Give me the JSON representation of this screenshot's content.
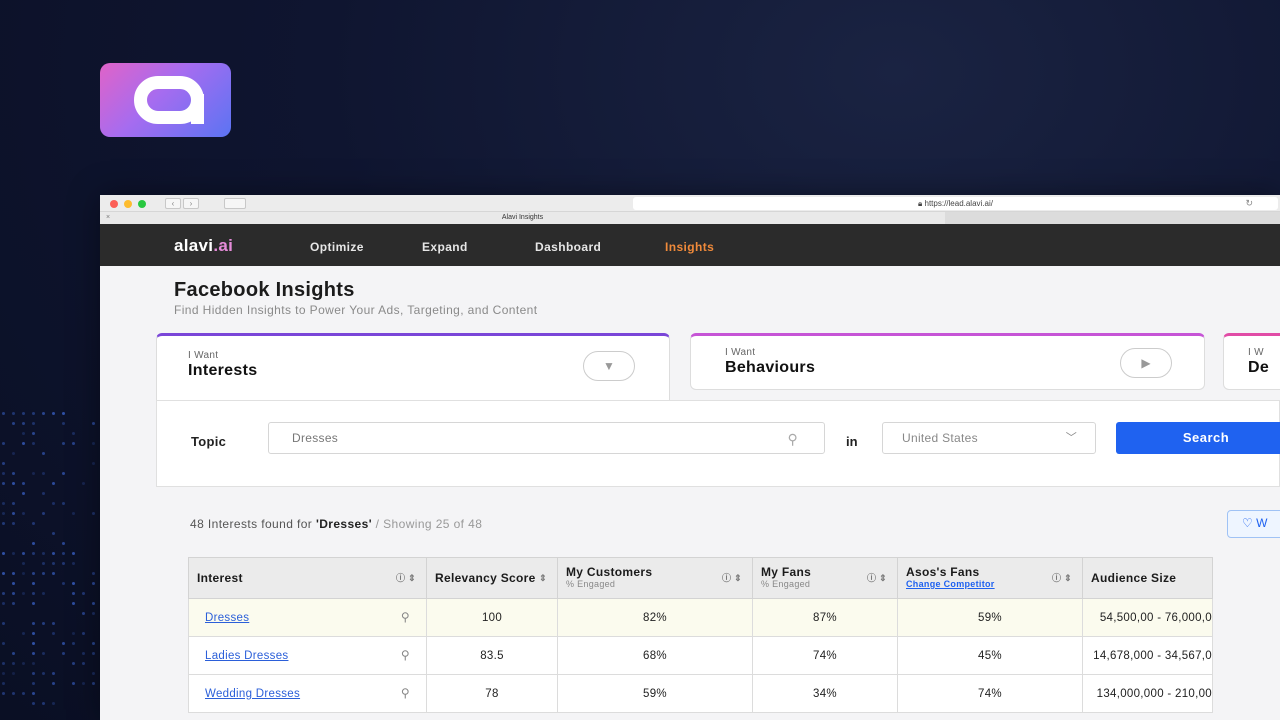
{
  "browser": {
    "url": "https://lead.alavi.ai/",
    "tab_title": "Alavi Insights"
  },
  "site": {
    "logo": "alavi",
    "logo_suffix": ".ai",
    "nav": [
      "Optimize",
      "Expand",
      "Dashboard",
      "Insights"
    ],
    "active_nav": "Insights"
  },
  "page": {
    "title": "Facebook Insights",
    "subtitle": "Find Hidden Insights to Power Your Ads, Targeting, and Content"
  },
  "cards": [
    {
      "label": "I Want",
      "title": "Interests"
    },
    {
      "label": "I Want",
      "title": "Behaviours"
    },
    {
      "label": "I W",
      "title": "De"
    }
  ],
  "search": {
    "topic_label": "Topic",
    "topic_value": "Dresses",
    "in_label": "in",
    "country": "United States",
    "button": "Search"
  },
  "results": {
    "count_text": "48 Interests found for ",
    "query": "'Dresses'",
    "showing": " / Showing 25 of 48",
    "action_button": "W"
  },
  "table": {
    "headers": [
      {
        "title": "Interest",
        "sub": ""
      },
      {
        "title": "Relevancy Score",
        "sub": ""
      },
      {
        "title": "My Customers",
        "sub": "% Engaged"
      },
      {
        "title": "My Fans",
        "sub": "% Engaged"
      },
      {
        "title": "Asos's Fans",
        "sub": "Change Competitor"
      },
      {
        "title": "Audience Size",
        "sub": ""
      }
    ],
    "rows": [
      {
        "interest": "Dresses",
        "score": "100",
        "customers": "82%",
        "fans": "87%",
        "competitor": "59%",
        "audience": "54,500,00 - 76,000,0"
      },
      {
        "interest": "Ladies Dresses",
        "score": "83.5",
        "customers": "68%",
        "fans": "74%",
        "competitor": "45%",
        "audience": "14,678,000 - 34,567,0"
      },
      {
        "interest": "Wedding Dresses",
        "score": "78",
        "customers": "59%",
        "fans": "34%",
        "competitor": "74%",
        "audience": "134,000,000 - 210,00"
      }
    ]
  }
}
